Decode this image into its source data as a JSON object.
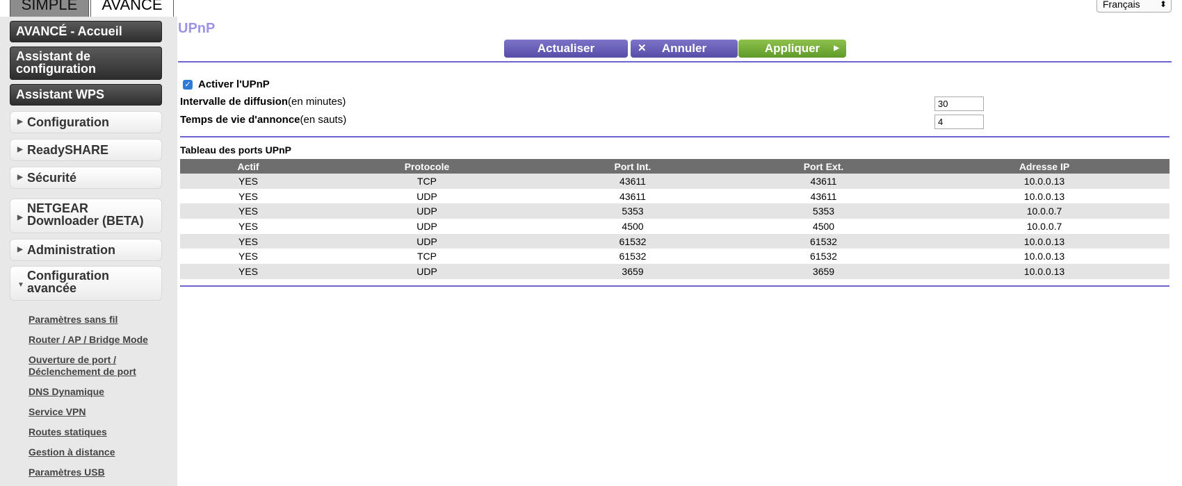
{
  "mode_tabs": {
    "simple": "SIMPLE",
    "avance": "AVANCÉ"
  },
  "language": {
    "selected": "Français",
    "arrows": "⬍"
  },
  "sidebar": {
    "home": "AVANCÉ - Accueil",
    "wizard_line1": "Assistant de",
    "wizard_line2": "configuration",
    "wps": "Assistant WPS",
    "menus": {
      "configuration": "Configuration",
      "readyshare": "ReadySHARE",
      "securite": "Sécurité",
      "downloader_line1": "NETGEAR",
      "downloader_line2": "Downloader (BETA)",
      "administration": "Administration",
      "advanced_line1": "Configuration",
      "advanced_line2": "avancée"
    },
    "links": {
      "wireless": "Paramètres sans fil",
      "router_mode": "Router / AP / Bridge Mode",
      "port_line1": "Ouverture de port /",
      "port_line2": "Déclenchement de port",
      "ddns": "DNS Dynamique",
      "vpn": "Service VPN",
      "routes": "Routes statiques",
      "remote": "Gestion à distance",
      "usb": "Paramètres USB"
    }
  },
  "main": {
    "title": "UPnP",
    "buttons": {
      "refresh": "Actualiser",
      "cancel": "Annuler",
      "apply": "Appliquer"
    },
    "enable_label": "Activer l'UPnP",
    "enable_checked": true,
    "interval_label": "Intervalle de diffusion",
    "interval_unit": "(en minutes)",
    "interval_value": "30",
    "ttl_label": "Temps de vie d'annonce",
    "ttl_unit": "(en sauts)",
    "ttl_value": "4",
    "table_caption": "Tableau des ports UPnP",
    "table_headers": [
      "Actif",
      "Protocole",
      "Port Int.",
      "Port Ext.",
      "Adresse IP"
    ],
    "table_rows": [
      [
        "YES",
        "TCP",
        "43611",
        "43611",
        "10.0.0.13"
      ],
      [
        "YES",
        "UDP",
        "43611",
        "43611",
        "10.0.0.13"
      ],
      [
        "YES",
        "UDP",
        "5353",
        "5353",
        "10.0.0.7"
      ],
      [
        "YES",
        "UDP",
        "4500",
        "4500",
        "10.0.0.7"
      ],
      [
        "YES",
        "UDP",
        "61532",
        "61532",
        "10.0.0.13"
      ],
      [
        "YES",
        "TCP",
        "61532",
        "61532",
        "10.0.0.13"
      ],
      [
        "YES",
        "UDP",
        "3659",
        "3659",
        "10.0.0.13"
      ]
    ]
  },
  "colors": {
    "accent": "#6b63cf",
    "apply": "#6fab35",
    "title": "#9d93e8"
  }
}
